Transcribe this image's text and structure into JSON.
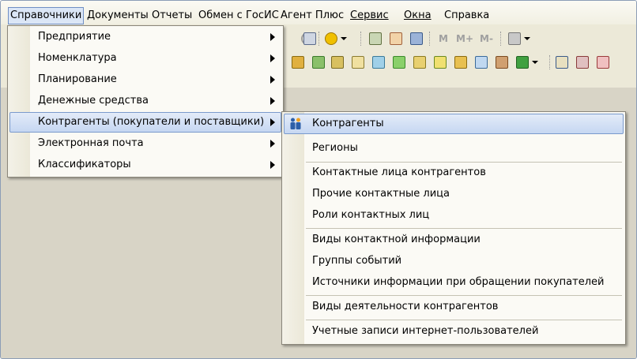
{
  "menubar": {
    "items": [
      "Справочники",
      "Документы",
      "Отчеты",
      "Обмен с ГосИС",
      "Агент Плюс",
      "Сервис",
      "Окна",
      "Справка"
    ]
  },
  "toolbar": {
    "memory_labels": [
      "M",
      "M+",
      "M-"
    ]
  },
  "menu_main": {
    "items": [
      {
        "label": "Предприятие"
      },
      {
        "label": "Номенклатура"
      },
      {
        "label": "Планирование"
      },
      {
        "label": "Денежные средства"
      },
      {
        "label": "Контрагенты (покупатели и поставщики)"
      },
      {
        "label": "Электронная почта"
      },
      {
        "label": "Классификаторы"
      }
    ]
  },
  "menu_sub": {
    "items": [
      {
        "label": "Контрагенты",
        "icon": "people-icon"
      },
      {
        "label": "Регионы"
      },
      {
        "label": "Контактные лица контрагентов"
      },
      {
        "label": "Прочие контактные лица"
      },
      {
        "label": "Роли контактных лиц"
      },
      {
        "label": "Виды контактной информации"
      },
      {
        "label": "Группы событий"
      },
      {
        "label": "Источники информации при обращении покупателей"
      },
      {
        "label": "Виды деятельности контрагентов"
      },
      {
        "label": "Учетные записи интернет-пользователей"
      }
    ]
  },
  "colors": {
    "menu_highlight": "#c6d7f2",
    "menubar_active": "#dbe6f6"
  }
}
